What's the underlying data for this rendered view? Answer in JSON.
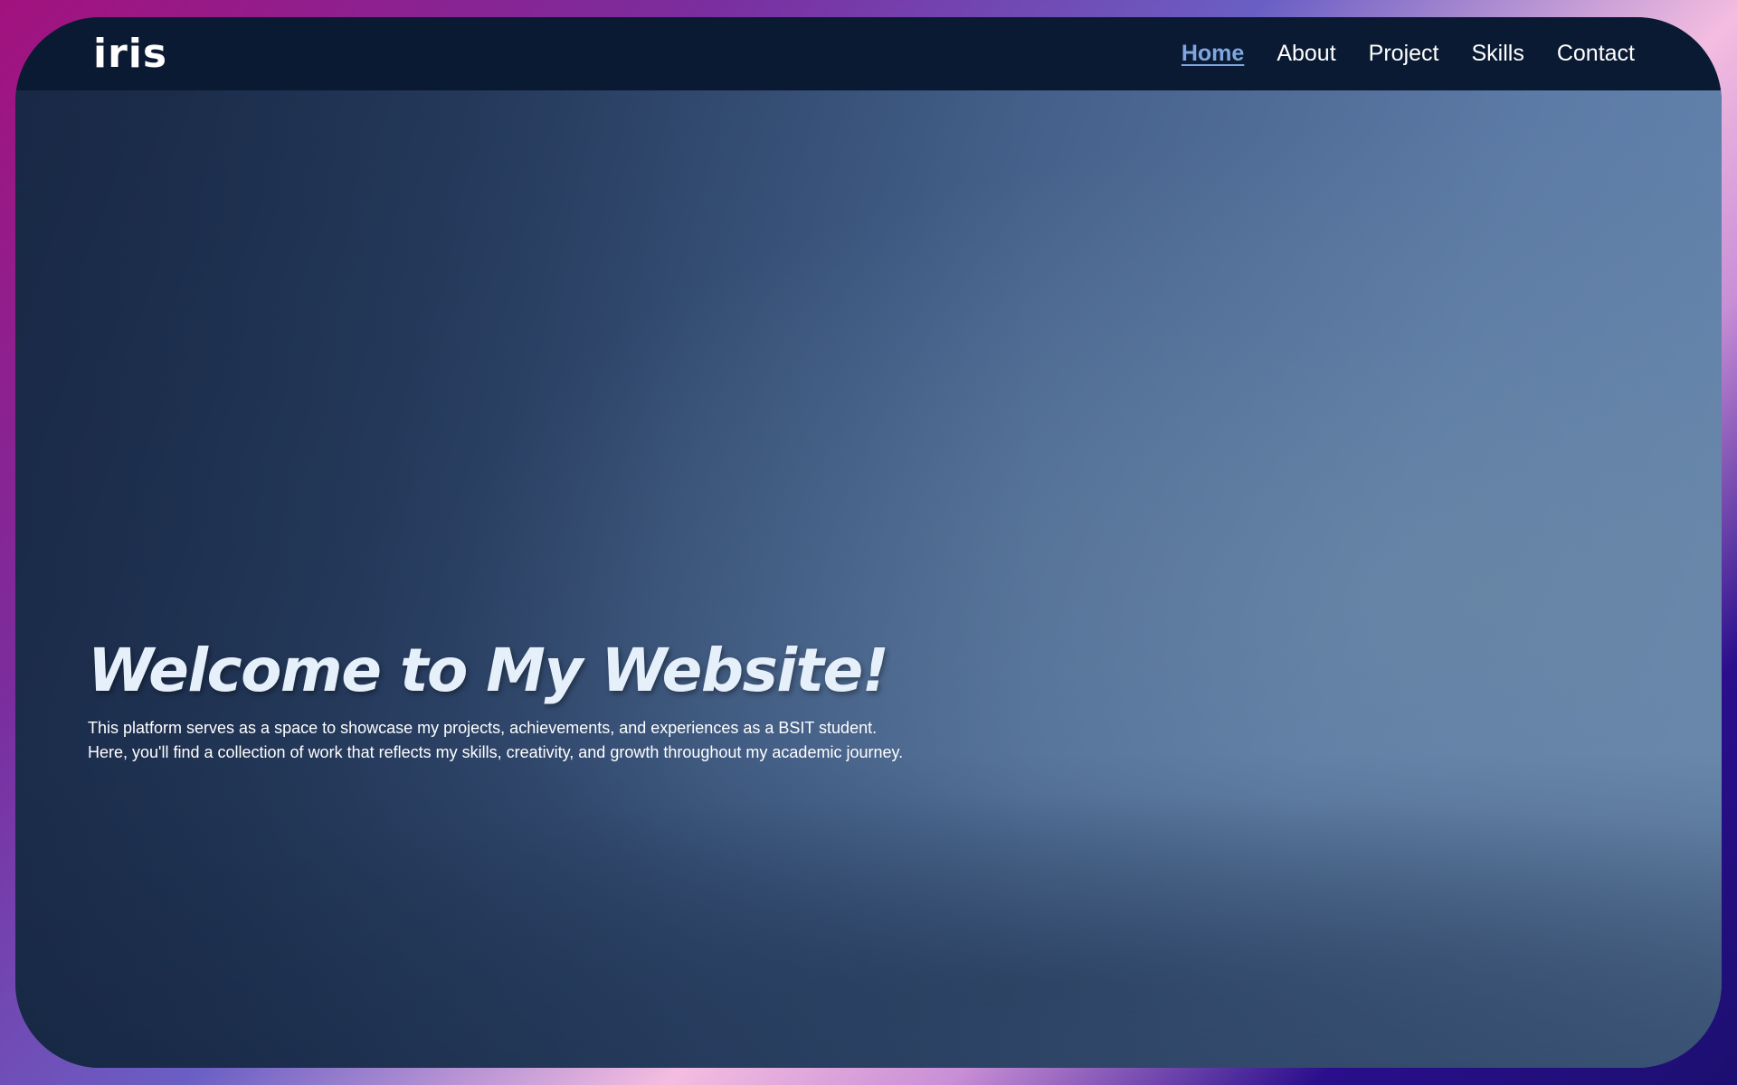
{
  "brand": {
    "logo_text": "iris"
  },
  "nav": {
    "items": [
      {
        "label": "Home",
        "active": true
      },
      {
        "label": "About",
        "active": false
      },
      {
        "label": "Project",
        "active": false
      },
      {
        "label": "Skills",
        "active": false
      },
      {
        "label": "Contact",
        "active": false
      }
    ]
  },
  "hero": {
    "title": "Welcome to My Website!",
    "description_line1": "This platform serves as a space to showcase my projects, achievements, and experiences as a BSIT student.",
    "description_line2": "Here, you'll find a collection of work that reflects my skills, creativity, and growth throughout my academic journey."
  },
  "colors": {
    "navbar_bg": "#0b1a33",
    "active_link": "#7ea6e0",
    "title_text": "#e6f0fb"
  }
}
